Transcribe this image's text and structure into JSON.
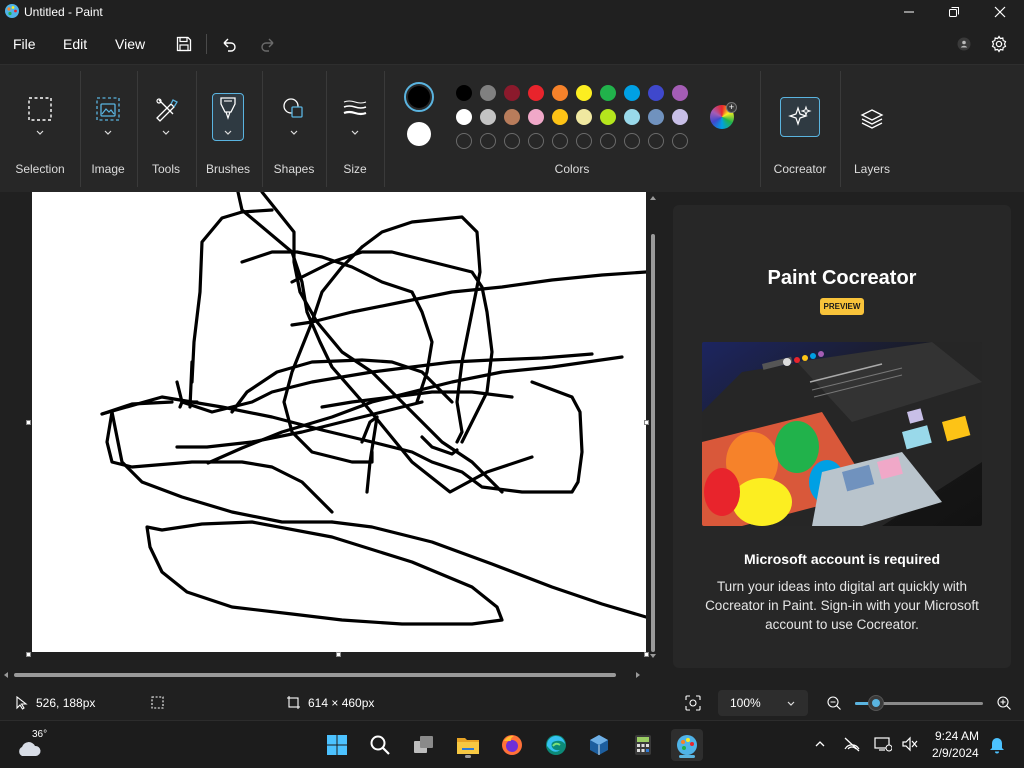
{
  "window": {
    "title": "Untitled - Paint",
    "minimize_icon": "minimize-icon",
    "maximize_icon": "maximize-icon",
    "close_icon": "close-icon"
  },
  "menu": {
    "file": "File",
    "edit": "Edit",
    "view": "View",
    "save_icon": "save-icon",
    "undo_icon": "undo-icon",
    "redo_icon": "redo-icon",
    "account_icon": "account-icon",
    "settings_icon": "settings-icon"
  },
  "ribbon": {
    "groups": [
      {
        "label": "Selection",
        "icon": "selection-icon"
      },
      {
        "label": "Image",
        "icon": "image-icon"
      },
      {
        "label": "Tools",
        "icon": "tools-icon"
      },
      {
        "label": "Brushes",
        "icon": "brush-icon"
      },
      {
        "label": "Shapes",
        "icon": "shapes-icon"
      },
      {
        "label": "Size",
        "icon": "size-icon"
      },
      {
        "label": "Colors",
        "icon": "colors-icon"
      },
      {
        "label": "Cocreator",
        "icon": "cocreator-icon"
      },
      {
        "label": "Layers",
        "icon": "layers-icon"
      }
    ],
    "primary_color": "#000000",
    "secondary_color": "#ffffff",
    "palette_row1": [
      "#000000",
      "#808080",
      "#8b1a2c",
      "#e8242c",
      "#f6822a",
      "#fcee21",
      "#21b24b",
      "#00a0e4",
      "#3f48cc",
      "#a45db5"
    ],
    "palette_row2": [
      "#ffffff",
      "#c3c3c3",
      "#b87c5b",
      "#f0a8c8",
      "#fdc316",
      "#f0e8a0",
      "#b5e61d",
      "#99d9ea",
      "#7092be",
      "#c8bfe7"
    ],
    "palette_row3_count": 10,
    "accent_color": "#5ab4e0"
  },
  "cocreator": {
    "title": "Paint Cocreator",
    "badge": "PREVIEW",
    "subheading": "Microsoft account is required",
    "body": "Turn your ideas into digital art quickly with Cocreator in Paint. Sign-in with your Microsoft account to use Cocreator."
  },
  "status": {
    "cursor_icon": "cursor-icon",
    "cursor_position": "526, 188px",
    "selection_icon": "selection-size-icon",
    "canvas_icon": "canvas-size-icon",
    "canvas_size": "614 × 460px",
    "fit_icon": "fit-to-window-icon",
    "zoom": "100%",
    "zoom_out_icon": "zoom-out-icon",
    "zoom_in_icon": "zoom-in-icon"
  },
  "taskbar": {
    "weather_temp": "36°",
    "time": "9:24 AM",
    "date": "2/9/2024",
    "apps": [
      "start-icon",
      "search-icon",
      "task-view-icon",
      "file-explorer-icon",
      "firefox-icon",
      "edge-icon",
      "virtualbox-icon",
      "calculator-icon",
      "paint-icon"
    ],
    "tray": [
      "chevron-up-icon",
      "network-off-icon",
      "display-icon",
      "volume-mute-icon",
      "notification-icon"
    ]
  }
}
